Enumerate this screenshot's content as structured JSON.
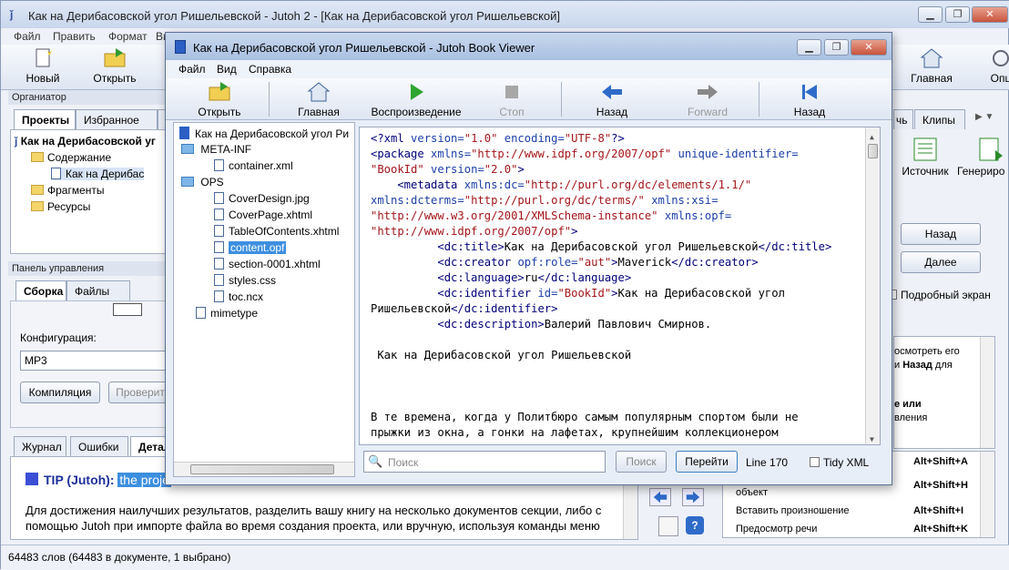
{
  "main": {
    "title": "Как на Дерибасовской угол Ришельевской - Jutoh 2 - [Как на Дерибасовской угол Ришельевской]",
    "menu": [
      "Файл",
      "Править",
      "Формат",
      "Ви"
    ],
    "toolbar": {
      "new": "Новый",
      "open": "Открыть",
      "home": "Главная",
      "options": "Опц"
    },
    "organizer": {
      "header": "Органиатор",
      "tabs": [
        "Проекты",
        "Избранное",
        "О"
      ],
      "tree": {
        "root": "Как на Дерибасовской уг",
        "contents": "Содержание",
        "chapter": "Как на Дерибас",
        "fragments": "Фрагменты",
        "resources": "Ресурсы"
      }
    },
    "control": {
      "header": "Панель управления",
      "tabs": [
        "Сборка",
        "Файлы"
      ],
      "config_label": "Конфигурация:",
      "config_value": "MP3",
      "compile": "Компиляция",
      "check": "Проверит"
    },
    "bottom_tabs": [
      "Журнал",
      "Ошибки",
      "Детал"
    ],
    "tip": {
      "prefix": "TIP (Jutoh):",
      "highlight": "the proje",
      "body": "Для достижения наилучших результатов, разделить вашу книгу на несколько документов секции, либо с помощью Jutoh при импорте файла во время создания проекта, или вручную, используя команды меню"
    },
    "right": {
      "tabs": [
        "чь",
        "Клипы"
      ],
      "source": "Источник",
      "generate": "Генериро",
      "back": "Назад",
      "next": "Далее",
      "detailed": "Подробный экран",
      "help1": "осмотреть его",
      "help2": "и",
      "help2b": "Назад",
      "help2c": "для",
      "help3": "е или",
      "help4": "вления",
      "shortcuts": [
        {
          "label": "",
          "key": "Alt+Shift+A"
        },
        {
          "label": "объект",
          "key": "Alt+Shift+H"
        },
        {
          "label": "Вставить произношение",
          "key": "Alt+Shift+I"
        },
        {
          "label": "Предосмотр речи",
          "key": "Alt+Shift+K"
        }
      ]
    },
    "status": "64483 слов (64483 в документе, 1 выбрано)"
  },
  "viewer": {
    "title": "Как на Дерибасовской угол Ришельевской - Jutoh Book Viewer",
    "menu": [
      "Файл",
      "Вид",
      "Справка"
    ],
    "toolbar": {
      "open": "Открыть",
      "home": "Главная",
      "play": "Воспроизведение",
      "stop": "Стоп",
      "back": "Назад",
      "forward": "Forward",
      "back2": "Назад"
    },
    "tree": {
      "root": "Как на Дерибасовской угол Ри",
      "meta": "META-INF",
      "container": "container.xml",
      "ops": "OPS",
      "files": [
        "CoverDesign.jpg",
        "CoverPage.xhtml",
        "TableOfContents.xhtml",
        "content.opf",
        "section-0001.xhtml",
        "styles.css",
        "toc.ncx"
      ],
      "mimetype": "mimetype"
    },
    "search_placeholder": "Поиск",
    "search_btn": "Поиск",
    "goto_btn": "Перейти",
    "line": "Line 170",
    "tidy": "Tidy XML",
    "code": {
      "l1a": "<?xml ",
      "l1b": "version=",
      "l1c": "\"1.0\"",
      "l1d": " encoding=",
      "l1e": "\"UTF-8\"",
      "l1f": "?>",
      "l2a": "<package ",
      "l2b": "xmlns=",
      "l2c": "\"http://www.idpf.org/2007/opf\"",
      "l2d": " unique-identifier=",
      "l3a": "\"BookId\"",
      "l3b": " version=",
      "l3c": "\"2.0\"",
      "l3d": ">",
      "l4a": "    <metadata ",
      "l4b": "xmlns:dc=",
      "l4c": "\"http://purl.org/dc/elements/1.1/\"",
      "l5a": "xmlns:dcterms=",
      "l5b": "\"http://purl.org/dc/terms/\"",
      "l5c": " xmlns:xsi=",
      "l6a": "\"http://www.w3.org/2001/XMLSchema-instance\"",
      "l6b": " xmlns:opf=",
      "l7a": "\"http://www.idpf.org/2007/opf\"",
      "l7b": ">",
      "l8a": "          <dc:title>",
      "l8b": "Как на Дерибасовской угол Ришельевской",
      "l8c": "</dc:title>",
      "l9a": "          <dc:creator ",
      "l9b": "opf:role=",
      "l9c": "\"aut\"",
      "l9d": ">",
      "l9e": "Maverick",
      "l9f": "</dc:creator>",
      "l10a": "          <dc:language>",
      "l10b": "ru",
      "l10c": "</dc:language>",
      "l11a": "          <dc:identifier ",
      "l11b": "id=",
      "l11c": "\"BookId\"",
      "l11d": ">",
      "l11e": "Как на Дерибасовской угол",
      "l12a": "Ришельевской",
      "l12b": "</dc:identifier>",
      "l13a": "          <dc:description>",
      "l13b": "Валерий Павлович Смирнов.",
      "l15": " Как на Дерибасовской угол Ришельевской",
      "l19": "В те времена, когда у Политбюро самым популярным спортом были не",
      "l20": "прыжки из окна, а гонки на лафетах, крупнейшим коллекционером"
    }
  }
}
